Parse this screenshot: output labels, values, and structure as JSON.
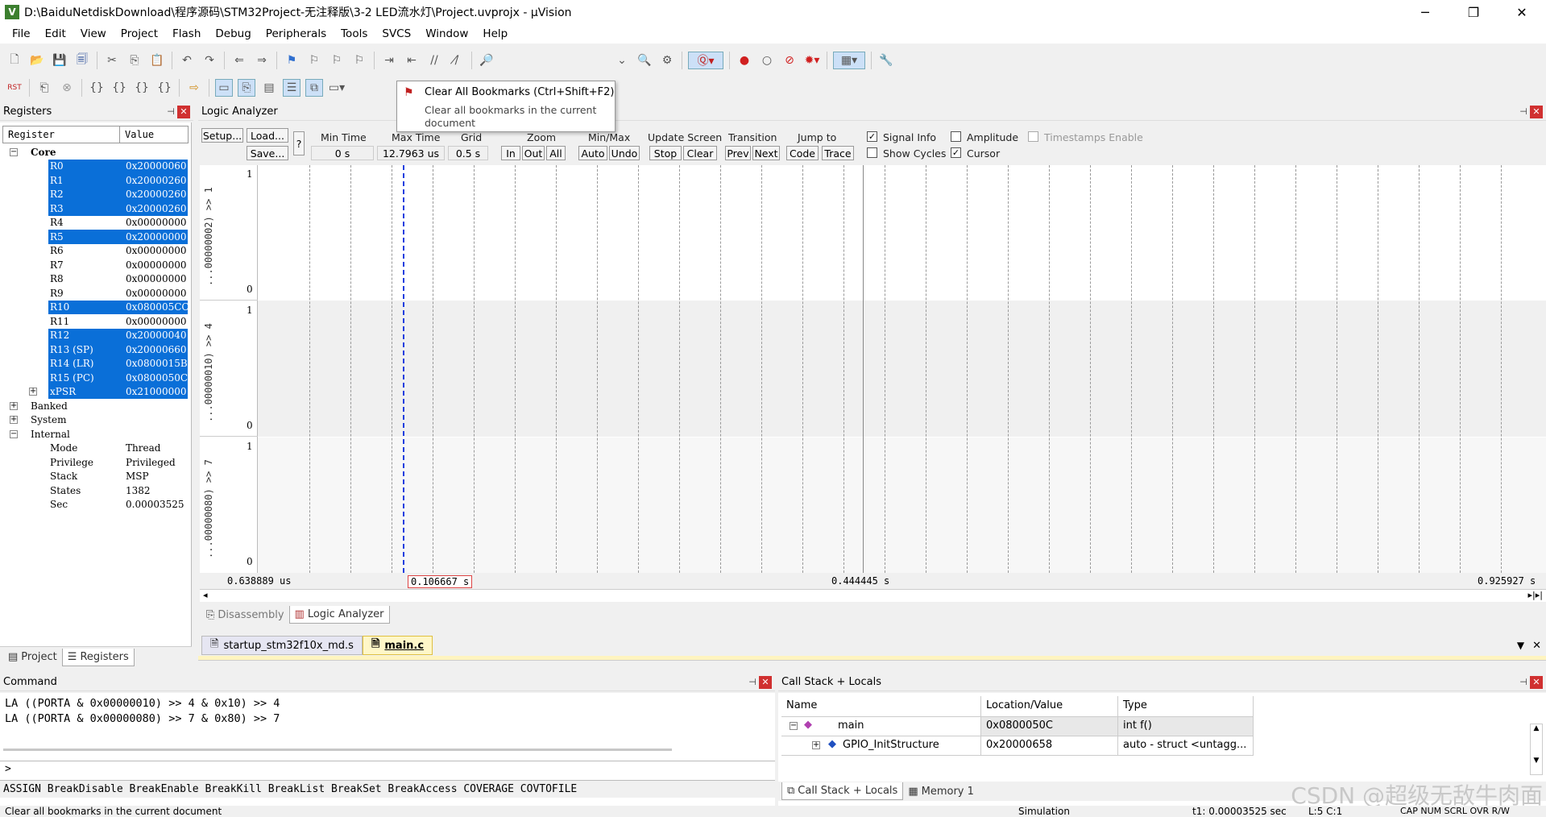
{
  "window": {
    "title": "D:\\BaiduNetdiskDownload\\程序源码\\STM32Project-无注释版\\3-2 LED流水灯\\Project.uvprojx - µVision",
    "app_icon": "V",
    "min": "─",
    "max": "❐",
    "close": "✕"
  },
  "menu": [
    "File",
    "Edit",
    "View",
    "Project",
    "Flash",
    "Debug",
    "Peripherals",
    "Tools",
    "SVCS",
    "Window",
    "Help"
  ],
  "tooltip": {
    "title": "Clear All Bookmarks (Ctrl+Shift+F2)",
    "desc": "Clear all bookmarks in the current document"
  },
  "registers": {
    "panel_title": "Registers",
    "col_register": "Register",
    "col_value": "Value",
    "core_label": "Core",
    "core": [
      {
        "name": "R0",
        "value": "0x20000060",
        "sel": true
      },
      {
        "name": "R1",
        "value": "0x20000260",
        "sel": true
      },
      {
        "name": "R2",
        "value": "0x20000260",
        "sel": true
      },
      {
        "name": "R3",
        "value": "0x20000260",
        "sel": true
      },
      {
        "name": "R4",
        "value": "0x00000000",
        "sel": false
      },
      {
        "name": "R5",
        "value": "0x20000000",
        "sel": true
      },
      {
        "name": "R6",
        "value": "0x00000000",
        "sel": false
      },
      {
        "name": "R7",
        "value": "0x00000000",
        "sel": false
      },
      {
        "name": "R8",
        "value": "0x00000000",
        "sel": false
      },
      {
        "name": "R9",
        "value": "0x00000000",
        "sel": false
      },
      {
        "name": "R10",
        "value": "0x080005CC",
        "sel": true
      },
      {
        "name": "R11",
        "value": "0x00000000",
        "sel": false
      },
      {
        "name": "R12",
        "value": "0x20000040",
        "sel": true
      },
      {
        "name": "R13 (SP)",
        "value": "0x20000660",
        "sel": true
      },
      {
        "name": "R14 (LR)",
        "value": "0x0800015B",
        "sel": true
      },
      {
        "name": "R15 (PC)",
        "value": "0x0800050C",
        "sel": true
      },
      {
        "name": "xPSR",
        "value": "0x21000000",
        "sel": true
      }
    ],
    "banked": "Banked",
    "system": "System",
    "internal_label": "Internal",
    "internal": [
      {
        "name": "Mode",
        "value": "Thread"
      },
      {
        "name": "Privilege",
        "value": "Privileged"
      },
      {
        "name": "Stack",
        "value": "MSP"
      },
      {
        "name": "States",
        "value": "1382"
      },
      {
        "name": "Sec",
        "value": "0.00003525"
      }
    ],
    "tab_project": "Project",
    "tab_registers": "Registers"
  },
  "logic_analyzer": {
    "panel_title": "Logic Analyzer",
    "setup": "Setup...",
    "load": "Load...",
    "save": "Save...",
    "help": "?",
    "min_time_label": "Min Time",
    "min_time": "0 s",
    "max_time_label": "Max Time",
    "max_time": "12.7963 us",
    "grid_label": "Grid",
    "grid": "0.5 s",
    "zoom_label": "Zoom",
    "zoom_in": "In",
    "zoom_out": "Out",
    "zoom_all": "All",
    "minmax_label": "Min/Max",
    "auto": "Auto",
    "undo": "Undo",
    "update_label": "Update Screen",
    "stop": "Stop",
    "clear": "Clear",
    "transition_label": "Transition",
    "prev": "Prev",
    "next": "Next",
    "jump_label": "Jump to",
    "code": "Code",
    "trace": "Trace",
    "signal_info": "Signal Info",
    "show_cycles": "Show Cycles",
    "amplitude": "Amplitude",
    "cursor": "Cursor",
    "timestamps": "Timestamps Enable",
    "signals": [
      {
        "name": "...00000002) >> 1",
        "hi": "1",
        "lo": "0"
      },
      {
        "name": "...00000010) >> 4",
        "hi": "1",
        "lo": "0"
      },
      {
        "name": "...00000080) >> 7",
        "hi": "1",
        "lo": "0"
      }
    ],
    "time_left": "0.638889 us",
    "time_cursor": "0.106667 s",
    "time_mid": "0.444445 s",
    "time_right": "0.925927 s",
    "tab_disassembly": "Disassembly",
    "tab_logic": "Logic Analyzer"
  },
  "files": {
    "tab1": "startup_stm32f10x_md.s",
    "tab2": "main.c"
  },
  "command": {
    "panel_title": "Command",
    "lines": [
      "LA ((PORTA & 0x00000010) >> 4 & 0x10) >> 4",
      "LA ((PORTA & 0x00000080) >> 7 & 0x80) >> 7"
    ],
    "prompt": ">",
    "keywords": "ASSIGN BreakDisable BreakEnable BreakKill BreakList BreakSet BreakAccess COVERAGE COVTOFILE"
  },
  "callstack": {
    "panel_title": "Call Stack + Locals",
    "col_name": "Name",
    "col_loc": "Location/Value",
    "col_type": "Type",
    "rows": [
      {
        "name": "main",
        "loc": "0x0800050C",
        "type": "int f()"
      },
      {
        "name": "GPIO_InitStructure",
        "loc": "0x20000658",
        "type": "auto - struct <untagg..."
      }
    ],
    "tab1": "Call Stack + Locals",
    "tab2": "Memory 1"
  },
  "status": {
    "left": "Clear all bookmarks in the current document",
    "sim": "Simulation",
    "t1": "t1: 0.00003525 sec",
    "pos": "L:5 C:1",
    "keys": "CAP NUM SCRL OVR R/W"
  },
  "watermark": "CSDN @超级无敌牛肉面",
  "colors": {
    "selection": "#0a6fd8",
    "cursor_line": "#1f3fdf"
  }
}
